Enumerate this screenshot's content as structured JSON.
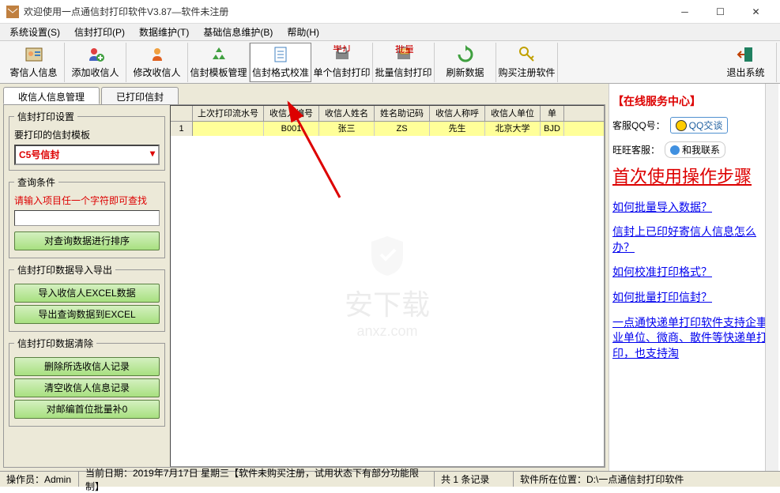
{
  "window": {
    "title": "欢迎使用一点通信封打印软件V3.87—软件未注册"
  },
  "menu": {
    "items": [
      "系统设置(S)",
      "信封打印(P)",
      "数据维护(T)",
      "基础信息维护(B)",
      "帮助(H)"
    ]
  },
  "toolbar": {
    "items": [
      "寄信人信息",
      "添加收信人",
      "修改收信人",
      "信封模板管理",
      "信封格式校准",
      "单个信封打印",
      "批量信封打印",
      "刷新数据",
      "购买注册软件",
      "退出系统"
    ]
  },
  "tabs": {
    "active": "收信人信息管理",
    "inactive": "已打印信封"
  },
  "sidebar": {
    "print_settings": {
      "legend": "信封打印设置",
      "template_label": "要打印的信封模板",
      "template_value": "C5号信封"
    },
    "query": {
      "legend": "查询条件",
      "hint": "请输入项目任一个字符即可查找",
      "sort_btn": "对查询数据进行排序"
    },
    "io": {
      "legend": "信封打印数据导入导出",
      "import_btn": "导入收信人EXCEL数据",
      "export_btn": "导出查询数据到EXCEL"
    },
    "clear": {
      "legend": "信封打印数据清除",
      "del_selected": "删除所选收信人记录",
      "clear_all": "清空收信人信息记录",
      "pad_zip": "对邮编首位批量补0"
    }
  },
  "grid": {
    "headers": [
      "上次打印流水号",
      "收信人编号",
      "收信人姓名",
      "姓名助记码",
      "收信人称呼",
      "收信人单位",
      "单"
    ],
    "row_num": "1",
    "row": [
      "",
      "B001",
      "张三",
      "ZS",
      "先生",
      "北京大学",
      "BJD"
    ]
  },
  "watermark": {
    "text": "安下载",
    "sub": "anxz.com"
  },
  "service": {
    "title": "【在线服务中心】",
    "qq_label": "客服QQ号：",
    "qq_badge": "QQ交谈",
    "ww_label": "旺旺客服：",
    "ww_badge": "和我联系",
    "big_link": "首次使用操作步骤",
    "links": [
      "如何批量导入数据？",
      "信封上已印好寄信人信息怎么办？",
      "如何校准打印格式？",
      "如何批量打印信封？",
      "一点通快递单打印软件支持企事业单位、微商、散件等快递单打印，也支持淘"
    ]
  },
  "status": {
    "operator": "操作员：Admin",
    "date": "当前日期：2019年7月17日 星期三【软件未购买注册，试用状态下有部分功能限制】",
    "count": "共 1 条记录",
    "location": "软件所在位置：D:\\一点通信封打印软件"
  }
}
